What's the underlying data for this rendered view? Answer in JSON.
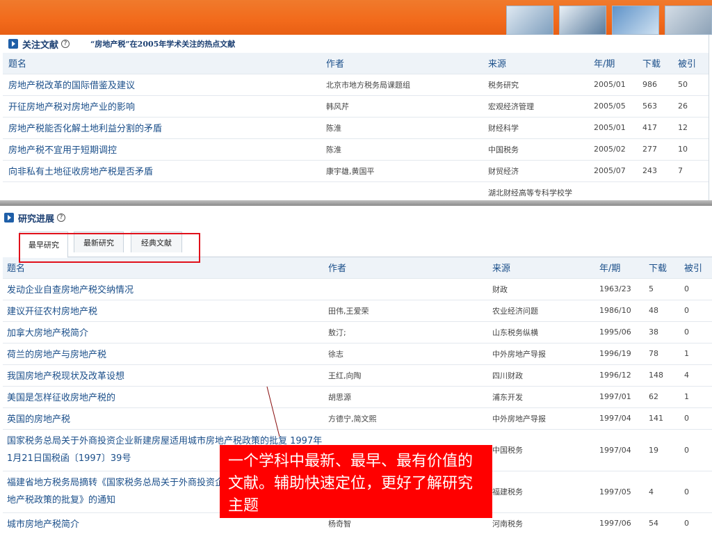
{
  "colors": {
    "banner": "#f26a1b",
    "link": "#1b4f8a",
    "callout_bg": "#ff0000",
    "highlight_border": "#e0101a"
  },
  "hot_section": {
    "title": "关注文献",
    "subtitle": "“房地产税”在2005年学术关注的热点文献",
    "help_icon": "question-circle-icon",
    "columns": [
      "题名",
      "作者",
      "来源",
      "年/期",
      "下载",
      "被引"
    ],
    "rows": [
      [
        "房地产税改革的国际借鉴及建议",
        "北京市地方税务局课题组",
        "税务研究",
        "2005/01",
        "986",
        "50"
      ],
      [
        "开征房地产税对房地产业的影响",
        "韩风芹",
        "宏观经济管理",
        "2005/05",
        "563",
        "26"
      ],
      [
        "房地产税能否化解土地利益分割的矛盾",
        "陈淮",
        "财经科学",
        "2005/01",
        "417",
        "12"
      ],
      [
        "房地产税不宜用于短期调控",
        "陈淮",
        "中国税务",
        "2005/02",
        "277",
        "10"
      ],
      [
        "向非私有土地征收房地产税是否矛盾",
        "康宇雄,黄国平",
        "财贸经济",
        "2005/07",
        "243",
        "7"
      ]
    ],
    "partial_source": "湖北财经高等专科学校学"
  },
  "research_section": {
    "title": "研究进展",
    "help_icon": "question-circle-icon",
    "tabs": [
      "最早研究",
      "最新研究",
      "经典文献"
    ],
    "active_tab": "最早研究",
    "columns": [
      "题名",
      "作者",
      "来源",
      "年/期",
      "下载",
      "被引"
    ],
    "rows": [
      [
        "发动企业自查房地产税交纳情况",
        "",
        "财政",
        "1963/23",
        "5",
        "0"
      ],
      [
        "建议开征农村房地产税",
        "田伟,王爱荣",
        "农业经济问题",
        "1986/10",
        "48",
        "0"
      ],
      [
        "加拿大房地产税简介",
        "敖汀;",
        "山东税务纵横",
        "1995/06",
        "38",
        "0"
      ],
      [
        "荷兰的房地产与房地产税",
        "徐志",
        "中外房地产导报",
        "1996/19",
        "78",
        "1"
      ],
      [
        "我国房地产税现状及改革设想",
        "王红,向陶",
        "四川财政",
        "1996/12",
        "148",
        "4"
      ],
      [
        "美国是怎样征收房地产税的",
        "胡思源",
        "浦东开发",
        "1997/01",
        "62",
        "1"
      ],
      [
        "英国的房地产税",
        "方德宁,简文熙",
        "中外房地产导报",
        "1997/04",
        "141",
        "0"
      ],
      [
        "国家税务总局关于外商投资企业新建房屋适用城市房地产税政策的批复 1997年1月21日国税函〔1997〕39号",
        "",
        "中国税务",
        "1997/04",
        "19",
        "0"
      ],
      [
        "福建省地方税务局摘转《国家税务总局关于外商投资企业新建房屋适用城市房地产税政策的批复》的通知",
        "",
        "福建税务",
        "1997/05",
        "4",
        "0"
      ],
      [
        "城市房地产税简介",
        "杨奇智",
        "河南税务",
        "1997/06",
        "54",
        "0"
      ]
    ]
  },
  "callout": {
    "text": "一个学科中最新、最早、最有价值的文献。辅助快速定位，更好了解研究主题"
  }
}
